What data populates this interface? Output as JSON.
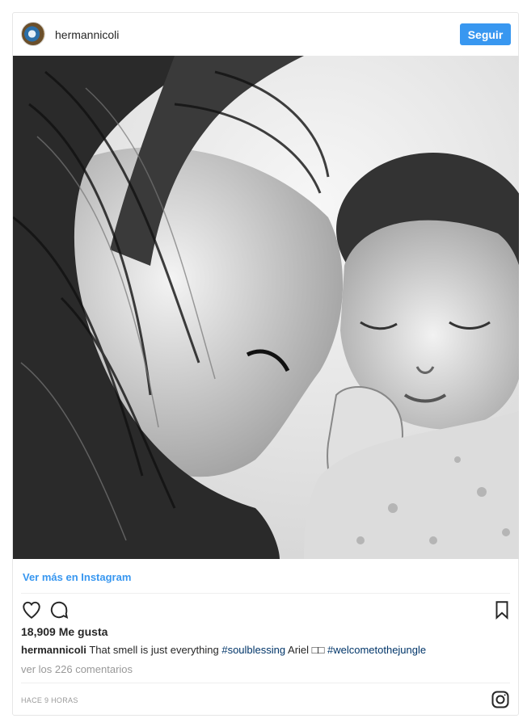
{
  "post": {
    "username": "hermannicoli",
    "follow_label": "Seguir",
    "photo_alt": "Foto",
    "view_more_label": "Ver más en Instagram",
    "likes_text": "18,909 Me gusta",
    "caption_user": "hermannicoli",
    "caption_text_1": "That smell is just everything",
    "caption_tag_1": "#soulblessing",
    "caption_text_2": "Ariel □□",
    "caption_tag_2": "#welcometothejungle",
    "comments_link": "ver los 226 comentarios",
    "timestamp": "HACE 9 HORAS"
  },
  "colors": {
    "accent": "#3897f0",
    "hashtag": "#003569",
    "muted": "#999999"
  },
  "icons": [
    "heart-icon",
    "comment-icon",
    "bookmark-icon",
    "instagram-logo-icon"
  ]
}
